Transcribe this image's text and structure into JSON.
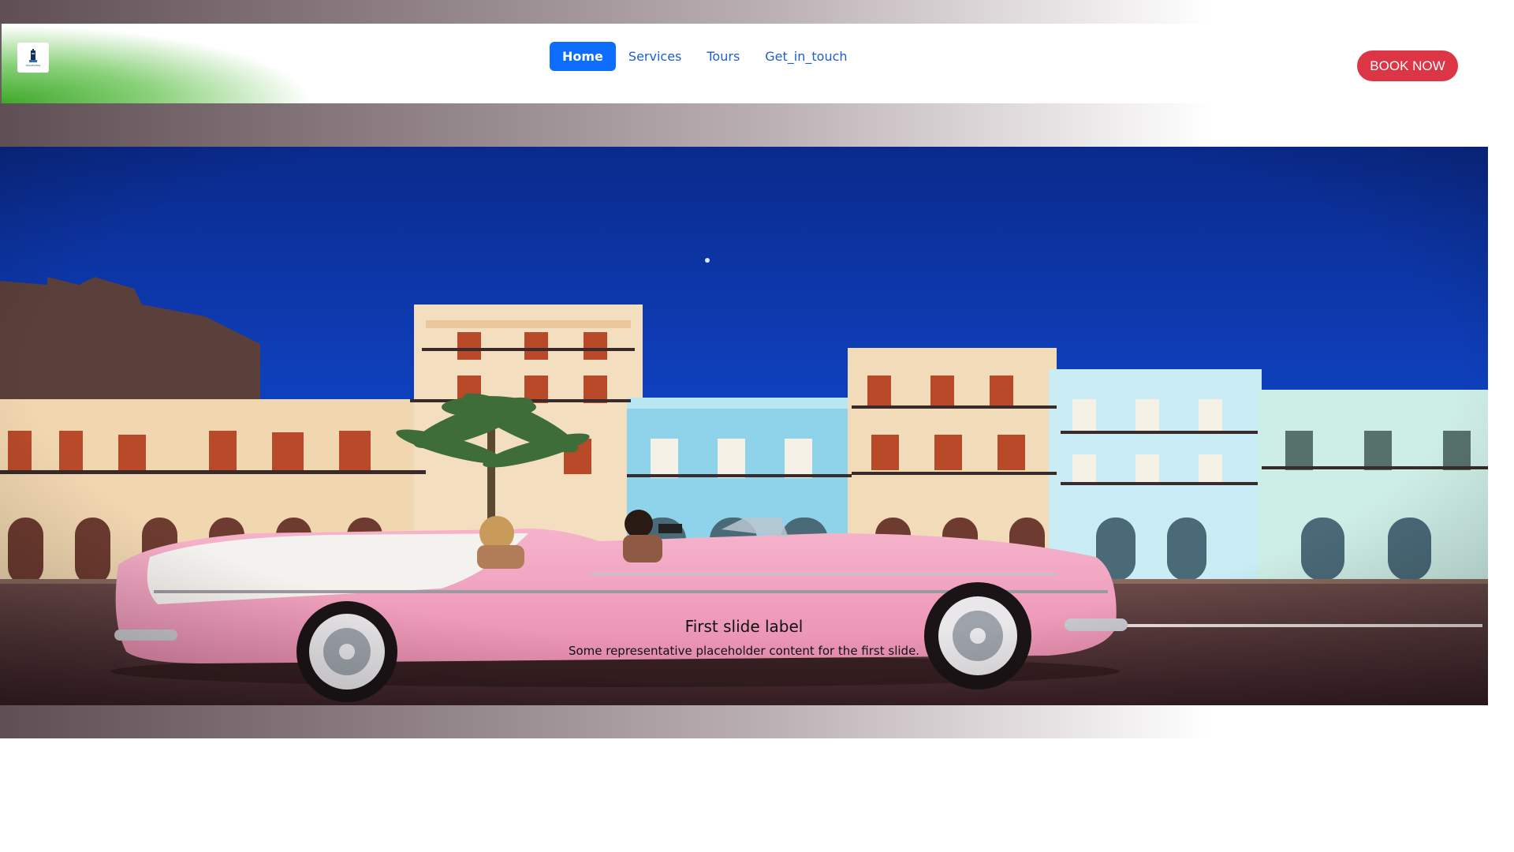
{
  "navbar": {
    "logo_icon": "travel-logo",
    "logo_text": "TRAVELERS",
    "links": [
      {
        "label": "Home",
        "active": true
      },
      {
        "label": "Services",
        "active": false
      },
      {
        "label": "Tours",
        "active": false
      },
      {
        "label": "Get_in_touch",
        "active": false
      }
    ],
    "book_button": "BOOK NOW",
    "colors": {
      "active": "#0d6efd",
      "link": "#1f5fcf",
      "book": "#dc3545"
    }
  },
  "carousel": {
    "slide_image": "pink-convertible-colorful-street",
    "caption_title": "First slide label",
    "caption_text": "Some representative placeholder content for the first slide."
  }
}
